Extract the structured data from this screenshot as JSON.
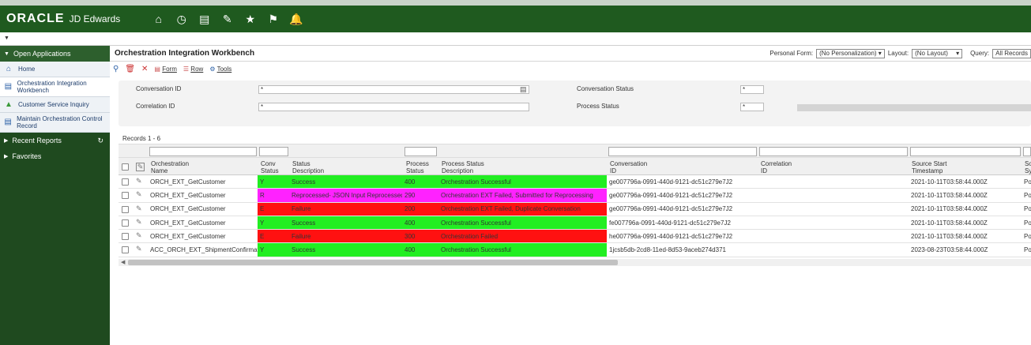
{
  "header": {
    "brand": "ORACLE",
    "product": "JD Edwards",
    "icons": [
      "home-icon",
      "recent-icon",
      "dashboard-icon",
      "edit-icon",
      "star-icon",
      "flag-icon",
      "bell-icon"
    ]
  },
  "sidebar": {
    "open_apps_label": "Open Applications",
    "items": [
      {
        "label": "Home",
        "icon": "home-icon"
      },
      {
        "label": "Orchestration Integration Workbench",
        "icon": "monitor-icon"
      },
      {
        "label": "Customer Service Inquiry",
        "icon": "puzzle-icon"
      },
      {
        "label": "Maintain Orchestration Control Record",
        "icon": "monitor-icon"
      }
    ],
    "recent_reports_label": "Recent Reports",
    "favorites_label": "Favorites"
  },
  "page": {
    "title": "Orchestration Integration Workbench",
    "personal_form_label": "Personal Form:",
    "personal_form_value": "(No Personalization)",
    "layout_label": "Layout:",
    "layout_value": "(No Layout)",
    "query_label": "Query:",
    "query_value": "All Records"
  },
  "toolbar": {
    "form_label": "Form",
    "row_label": "Row",
    "tools_label": "Tools"
  },
  "filters": {
    "conversation_id_label": "Conversation ID",
    "conversation_id_value": "*",
    "correlation_id_label": "Correlation ID",
    "correlation_id_value": "*",
    "conversation_status_label": "Conversation Status",
    "conversation_status_value": "*",
    "process_status_label": "Process Status",
    "process_status_value": "*"
  },
  "grid": {
    "records_label": "Records 1 - 6",
    "headers": {
      "orchestration": "Orchestration\nName",
      "conv_status": "Conv\nStatus",
      "status_desc": "Status\nDescription",
      "process_status": "Process\nStatus",
      "process_desc": "Process Status\nDescription",
      "conversation_id": "Conversation\nID",
      "correlation_id": "Correlation\nID",
      "source_start": "Source Start\nTimestamp",
      "so": "So\nSy"
    },
    "colors": {
      "success": "#22ee22",
      "reprocessed": "#ff22ff",
      "failure": "#ff1111"
    },
    "rows": [
      {
        "name": "ORCH_EXT_GetCustomer",
        "conv": "Y",
        "status_desc": "Success",
        "proc": "400",
        "proc_desc": "Orchestration Successful",
        "conv_id": "ge007796a-0991-440d-9121-dc51c279e7J2",
        "corr": "",
        "ts": "2021-10-11T03:58:44.000Z",
        "so": "Pos",
        "state": "success"
      },
      {
        "name": "ORCH_EXT_GetCustomer",
        "conv": "R",
        "status_desc": "Reprocessed- JSON Input Reprocessed",
        "proc": "290",
        "proc_desc": "Orchestration EXT Failed, Submitted for Reprocessing",
        "conv_id": "ge007796a-0991-440d-9121-dc51c279e7J2",
        "corr": "",
        "ts": "2021-10-11T03:58:44.000Z",
        "so": "Pos",
        "state": "reprocessed"
      },
      {
        "name": "ORCH_EXT_GetCustomer",
        "conv": "E",
        "status_desc": "Failure",
        "proc": "200",
        "proc_desc": "Orchestration EXT Failed, Duplicate Conversation",
        "conv_id": "ge007796a-0991-440d-9121-dc51c279e7J2",
        "corr": "",
        "ts": "2021-10-11T03:58:44.000Z",
        "so": "Pos",
        "state": "failure"
      },
      {
        "name": "ORCH_EXT_GetCustomer",
        "conv": "Y",
        "status_desc": "Success",
        "proc": "400",
        "proc_desc": "Orchestration Successful",
        "conv_id": "fe007796a-0991-440d-9121-dc51c279e7J2",
        "corr": "",
        "ts": "2021-10-11T03:58:44.000Z",
        "so": "Pos",
        "state": "success"
      },
      {
        "name": "ORCH_EXT_GetCustomer",
        "conv": "E",
        "status_desc": "Failure",
        "proc": "300",
        "proc_desc": "Orchestration Failed",
        "conv_id": "he007796a-0991-440d-9121-dc51c279e7J2",
        "corr": "",
        "ts": "2021-10-11T03:58:44.000Z",
        "so": "Pos",
        "state": "failure"
      },
      {
        "name": "ACC_ORCH_EXT_ShipmentConfirmat...",
        "conv": "Y",
        "status_desc": "Success",
        "proc": "400",
        "proc_desc": "Orchestration Successful",
        "conv_id": "1jcsb5db-2cd8-11ed-8d53-9aceb274d371",
        "corr": "",
        "ts": "2023-08-23T03:58:44.000Z",
        "so": "Pos",
        "state": "success"
      }
    ]
  }
}
